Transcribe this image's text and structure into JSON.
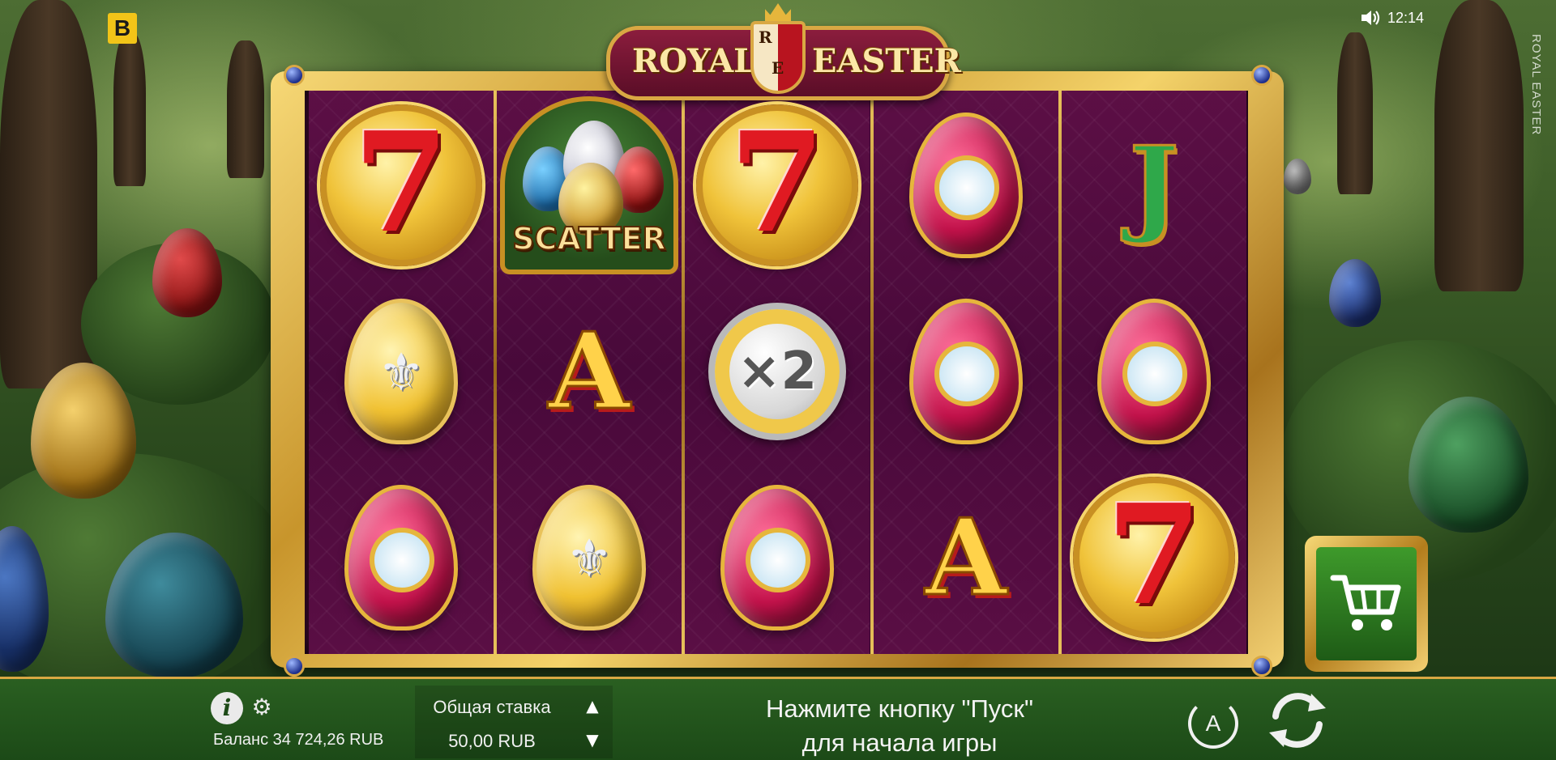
{
  "top": {
    "brand_badge": "B",
    "sound_icon": "speaker-icon",
    "clock": "12:14",
    "side_title": "ROYAL EASTER"
  },
  "logo": {
    "word_left": "ROYAL",
    "word_right": "EASTER",
    "shield_letter_top": "R",
    "shield_letter_bottom": "E"
  },
  "reels": [
    [
      "seven",
      "gold-egg",
      "clock-egg"
    ],
    [
      "scatter",
      "letter-A",
      "gold-egg"
    ],
    [
      "seven",
      "x2-coin",
      "clock-egg"
    ],
    [
      "clock-egg",
      "clock-egg",
      "letter-A"
    ],
    [
      "letter-J",
      "clock-egg",
      "seven"
    ]
  ],
  "symbols": {
    "seven_label": "7",
    "letter_a": "A",
    "letter_j": "J",
    "x2_label": "×2",
    "scatter_label": "SCATTER",
    "fleur": "⚜",
    "clock": "🕛"
  },
  "bottom_bar": {
    "info_label": "i",
    "balance_text": "Баланс 34 724,26 RUB",
    "bet_label": "Общая ставка",
    "bet_value": "50,00 RUB",
    "message_line1": "Нажмите кнопку \"Пуск\"",
    "message_line2": "для начала игры",
    "auto_label": "A"
  },
  "colors": {
    "accent_gold": "#d9a843",
    "bar_green": "#2a5f21",
    "reel_purple": "#4e0c3c"
  }
}
